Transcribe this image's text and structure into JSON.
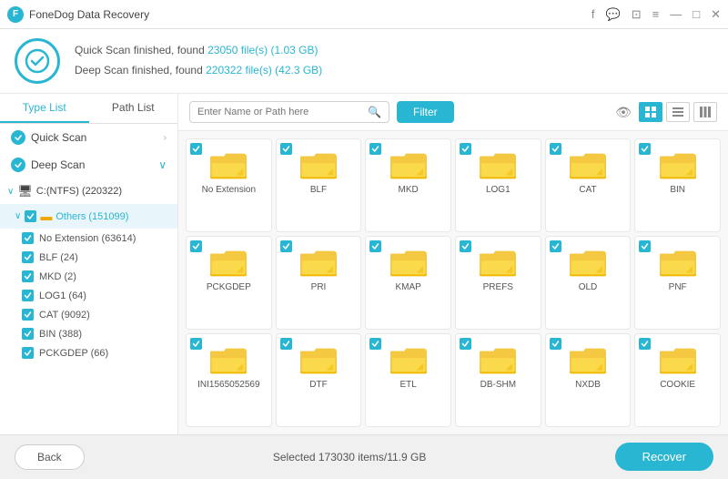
{
  "titleBar": {
    "appName": "FoneDog Data Recovery",
    "controls": [
      "f",
      "☐",
      "⊡",
      "≡",
      "—",
      "□",
      "✕"
    ]
  },
  "header": {
    "quickScanLine": "Quick Scan finished, found 23050 file(s) (1.03 GB)",
    "quickScanHighlight": "23050 file(s) (1.03 GB)",
    "deepScanLine": "Deep Scan finished, found 220322 file(s) (42.3 GB)",
    "deepScanHighlight": "220322 file(s) (42.3 GB)"
  },
  "tabs": {
    "typeList": "Type List",
    "pathList": "Path List"
  },
  "sidebar": {
    "quickScan": "Quick Scan",
    "deepScan": "Deep Scan",
    "drive": "C:(NTFS) (220322)",
    "folder": "Others (151099)",
    "fileTypes": [
      {
        "name": "No Extension",
        "count": 63614
      },
      {
        "name": "BLF",
        "count": 24
      },
      {
        "name": "MKD",
        "count": 2
      },
      {
        "name": "LOG1",
        "count": 64
      },
      {
        "name": "CAT",
        "count": 9092
      },
      {
        "name": "BIN",
        "count": 388
      },
      {
        "name": "PCKGDEP",
        "count": 66
      }
    ]
  },
  "toolbar": {
    "searchPlaceholder": "Enter Name or Path here",
    "filterLabel": "Filter"
  },
  "fileTiles": [
    {
      "label": "No Extension"
    },
    {
      "label": "BLF"
    },
    {
      "label": "MKD"
    },
    {
      "label": "LOG1"
    },
    {
      "label": "CAT"
    },
    {
      "label": "BIN"
    },
    {
      "label": "PCKGDEP"
    },
    {
      "label": "PRI"
    },
    {
      "label": "KMAP"
    },
    {
      "label": "PREFS"
    },
    {
      "label": "OLD"
    },
    {
      "label": "PNF"
    },
    {
      "label": "INI1565052569"
    },
    {
      "label": "DTF"
    },
    {
      "label": "ETL"
    },
    {
      "label": "DB-SHM"
    },
    {
      "label": "NXDB"
    },
    {
      "label": "COOKIE"
    }
  ],
  "footer": {
    "backLabel": "Back",
    "selectedInfo": "Selected 173030 items/11.9 GB",
    "recoverLabel": "Recover"
  }
}
